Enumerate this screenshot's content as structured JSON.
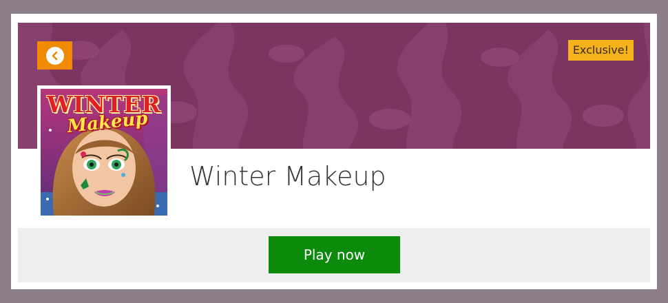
{
  "game": {
    "title": "Winter Makeup",
    "badge": "Exclusive!",
    "thumbnail_title": "WINTER",
    "thumbnail_subtitle": "Makeup"
  },
  "actions": {
    "back_icon": "chevron-left-icon",
    "play_label": "Play now"
  },
  "colors": {
    "page_bg": "#8c7f8a",
    "banner": "#7b3560",
    "back_button": "#f08a00",
    "badge": "#f5b21a",
    "play_button": "#0b8a0b",
    "play_bar": "#eeeeee"
  }
}
